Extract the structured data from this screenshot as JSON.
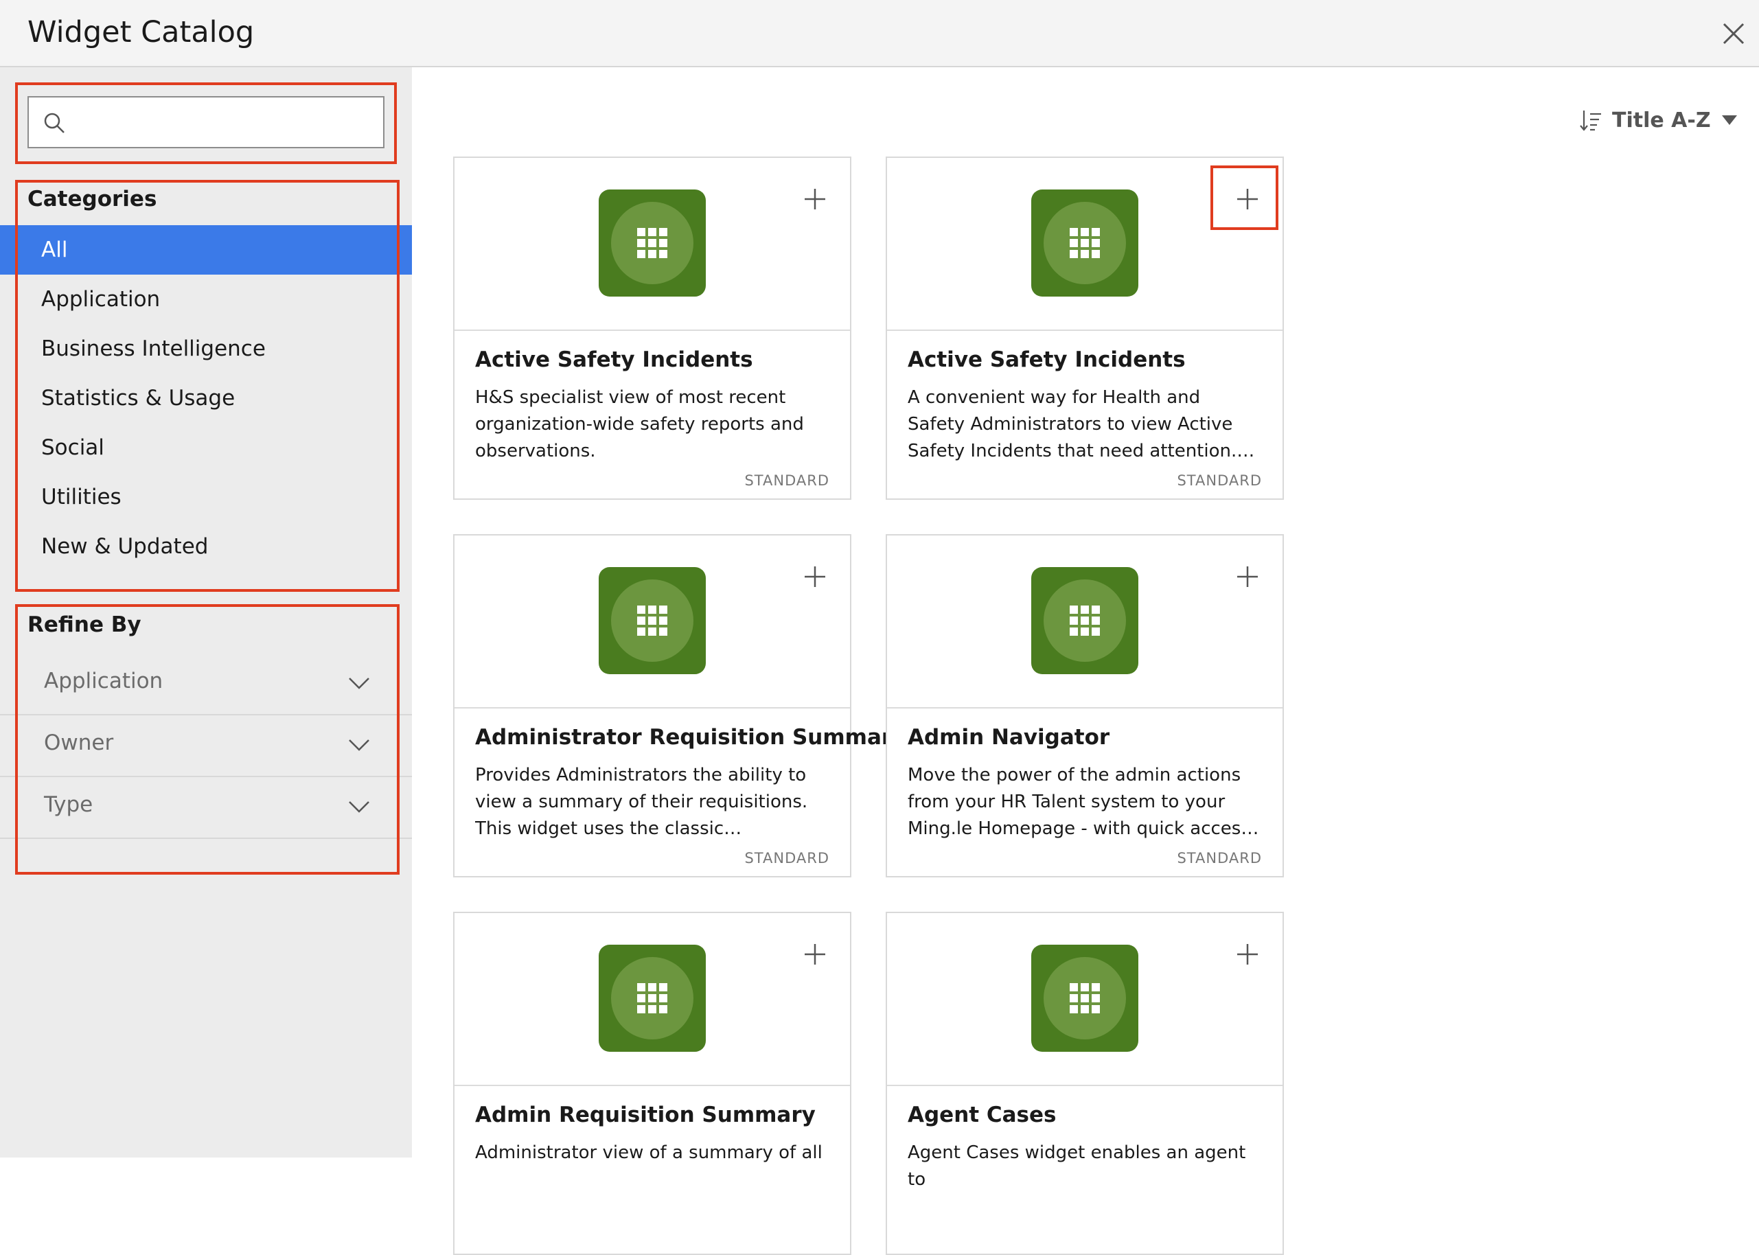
{
  "window": {
    "title": "Widget Catalog"
  },
  "search": {
    "placeholder": "",
    "value": ""
  },
  "categories": {
    "heading": "Categories",
    "items": [
      {
        "label": "All",
        "selected": true
      },
      {
        "label": "Application"
      },
      {
        "label": "Business Intelligence"
      },
      {
        "label": "Statistics & Usage"
      },
      {
        "label": "Social"
      },
      {
        "label": "Utilities"
      },
      {
        "label": "New & Updated"
      }
    ]
  },
  "refine": {
    "heading": "Refine By",
    "items": [
      {
        "label": "Application"
      },
      {
        "label": "Owner"
      },
      {
        "label": "Type"
      }
    ]
  },
  "sort": {
    "label": "Title A-Z"
  },
  "colors": {
    "accent": "#3b7ae8",
    "tile": "#4a7c1f",
    "highlight": "#e03c1f"
  },
  "widgets": [
    {
      "title": "Active Safety Incidents",
      "description": "H&S specialist view of most recent organization-wide safety reports and observations.",
      "type": "STANDARD",
      "icon": "grid-icon"
    },
    {
      "title": "Active Safety Incidents",
      "description": "A convenient way for Health and Safety Administrators to view Active Safety Incidents that need attention. This widget…",
      "type": "STANDARD",
      "icon": "grid-icon"
    },
    {
      "title": "Administrator Requisition Summary",
      "description": "Provides Administrators the ability to view a summary of their requisitions. This widget uses the classic experience.",
      "type": "STANDARD",
      "icon": "grid-icon"
    },
    {
      "title": "Admin Navigator",
      "description": "Move the power of the admin actions from your HR Talent system to your Ming.le Homepage - with quick access to data for …",
      "type": "STANDARD",
      "icon": "grid-icon"
    },
    {
      "title": "Admin Requisition Summary",
      "description": "Administrator view of a summary of all",
      "type": "",
      "icon": "grid-icon"
    },
    {
      "title": "Agent Cases",
      "description": "Agent Cases widget enables an agent to",
      "type": "",
      "icon": "grid-icon"
    }
  ]
}
